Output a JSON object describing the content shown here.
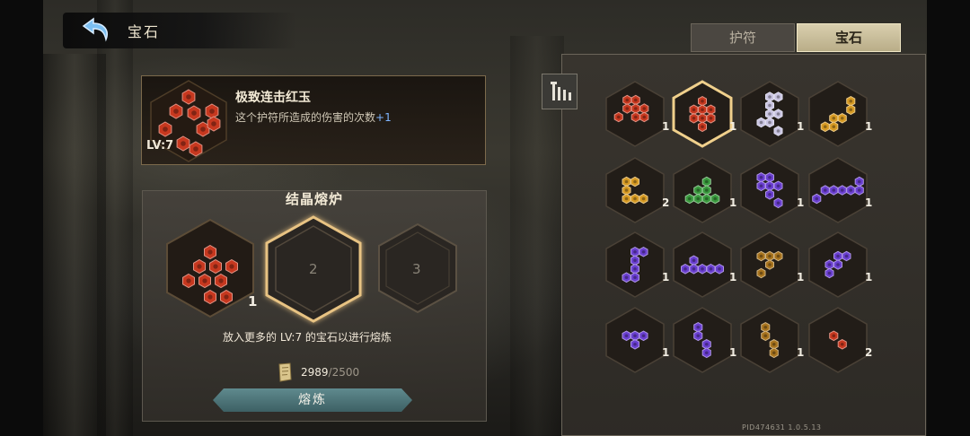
{
  "header": {
    "title": "宝石"
  },
  "tabs": [
    {
      "label": "护符",
      "active": false
    },
    {
      "label": "宝石",
      "active": true
    }
  ],
  "selected_gem": {
    "name": "极致连击红玉",
    "description": "这个护符所造成的伤害的次数",
    "bonus": "+1",
    "level": "LV:7",
    "color": "#c7381f"
  },
  "furnace": {
    "title": "结晶熔炉",
    "slots": [
      {
        "label": "",
        "count": "1",
        "filled": true
      },
      {
        "label": "2",
        "count": "",
        "filled": false
      },
      {
        "label": "3",
        "count": "",
        "filled": false
      }
    ],
    "hint": "放入更多的 LV:7 的宝石以进行熔炼",
    "cost_current": "2989",
    "cost_max": "/2500",
    "smelt_label": "熔炼"
  },
  "gem_grid": {
    "items": [
      {
        "color": "#c7381f",
        "count": "1",
        "selected": false
      },
      {
        "color": "#c7381f",
        "count": "1",
        "selected": true
      },
      {
        "color": "#c9c4e2",
        "count": "1",
        "selected": false
      },
      {
        "color": "#d69a23",
        "count": "1",
        "selected": false
      },
      {
        "color": "#d69a23",
        "count": "2",
        "selected": false
      },
      {
        "color": "#3a9a3e",
        "count": "1",
        "selected": false
      },
      {
        "color": "#6a3fd0",
        "count": "1",
        "selected": false
      },
      {
        "color": "#6a3fd0",
        "count": "1",
        "selected": false
      },
      {
        "color": "#6a3fd0",
        "count": "1",
        "selected": false
      },
      {
        "color": "#6a3fd0",
        "count": "1",
        "selected": false
      },
      {
        "color": "#a8741e",
        "count": "1",
        "selected": false
      },
      {
        "color": "#6a3fd0",
        "count": "1",
        "selected": false
      },
      {
        "color": "#6a3fd0",
        "count": "1",
        "selected": false
      },
      {
        "color": "#6a3fd0",
        "count": "1",
        "selected": false
      },
      {
        "color": "#a8741e",
        "count": "1",
        "selected": false
      },
      {
        "color": "#c7381f",
        "count": "2",
        "selected": false
      }
    ]
  },
  "footer": {
    "pid": "PID474631  1.0.5.13"
  },
  "icons": {
    "back": "back-arrow-icon",
    "filter": "filter-icon",
    "cost": "scroll-icon"
  }
}
